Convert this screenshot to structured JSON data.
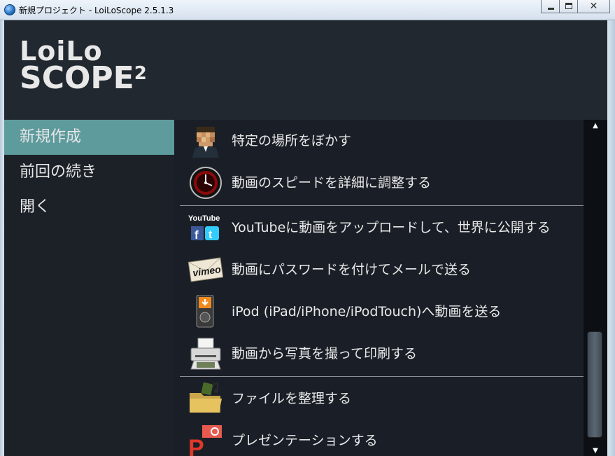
{
  "window": {
    "title": "新規プロジェクト - LoiLoScope 2.5.1.3",
    "close_glyph": "✕"
  },
  "logo": {
    "line1": "LoiLo",
    "line2": "SCOPE",
    "superscript": "2"
  },
  "nav": {
    "items": [
      {
        "label": "新規作成",
        "active": true
      },
      {
        "label": "前回の続き",
        "active": false
      },
      {
        "label": "開く",
        "active": false
      }
    ]
  },
  "list": {
    "items": [
      {
        "label": "特定の場所をぼかす",
        "icon": "pixelated-face-icon"
      },
      {
        "label": "動画のスピードを詳細に調整する",
        "icon": "clock-speed-icon"
      },
      {
        "label": "YouTubeに動画をアップロードして、世界に公開する",
        "icon": "youtube-social-icon",
        "icon_text": "YouTube"
      },
      {
        "label": "動画にパスワードを付けてメールで送る",
        "icon": "vimeo-envelope-icon",
        "icon_text": "vimeo"
      },
      {
        "label": "iPod (iPad/iPhone/iPodTouch)へ動画を送る",
        "icon": "ipod-download-icon"
      },
      {
        "label": "動画から写真を撮って印刷する",
        "icon": "printer-icon"
      },
      {
        "label": "ファイルを整理する",
        "icon": "folder-music-icon"
      },
      {
        "label": "プレゼンテーションする",
        "icon": "presentation-icon",
        "icon_text": "P"
      }
    ]
  },
  "scrollbar": {
    "up_arrow": "▲",
    "down_arrow": "▼"
  }
}
